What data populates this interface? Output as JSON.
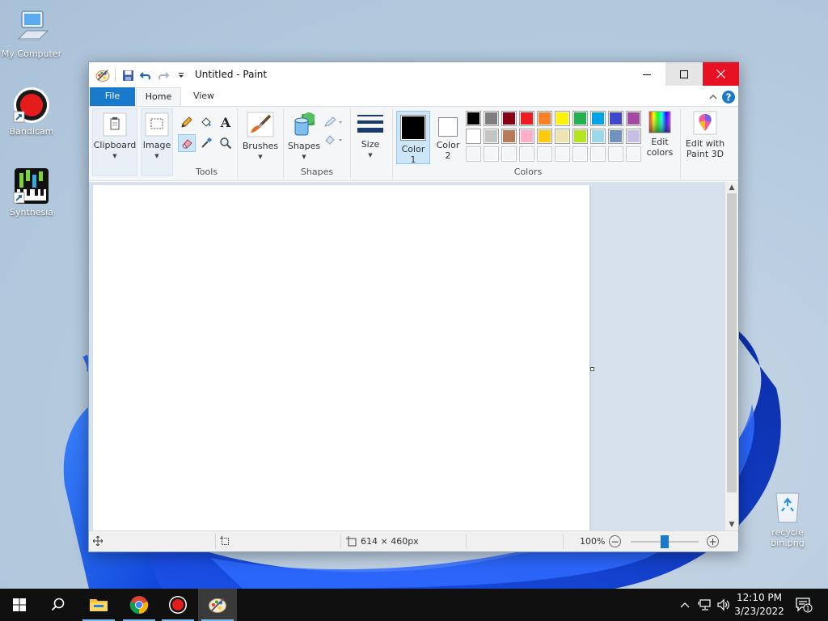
{
  "desktop": {
    "icons": [
      {
        "label": "My Computer"
      },
      {
        "label": "Bandicam"
      },
      {
        "label": "Synthesia"
      },
      {
        "label": "recycle bin.png"
      }
    ]
  },
  "window": {
    "title": "Untitled - Paint",
    "tabs": {
      "file": "File",
      "home": "Home",
      "view": "View"
    },
    "ribbon": {
      "clipboard": "Clipboard",
      "image": "Image",
      "tools_group": "Tools",
      "brushes": "Brushes",
      "shapes": "Shapes",
      "shapes_group": "Shapes",
      "size": "Size",
      "color1_line1": "Color",
      "color1_line2": "1",
      "color2_line1": "Color",
      "color2_line2": "2",
      "colors_group": "Colors",
      "edit_colors_line1": "Edit",
      "edit_colors_line2": "colors",
      "paint3d_line1": "Edit with",
      "paint3d_line2": "Paint 3D"
    },
    "palette_row1": [
      "#000000",
      "#7f7f7f",
      "#880015",
      "#ed1c24",
      "#ff7f27",
      "#fff200",
      "#22b14c",
      "#00a2e8",
      "#3f48cc",
      "#a349a4"
    ],
    "palette_row2": [
      "#ffffff",
      "#c3c3c3",
      "#b97a57",
      "#ffaec9",
      "#ffc90e",
      "#efe4b0",
      "#b5e61d",
      "#99d9ea",
      "#7092be",
      "#c8bfe7"
    ],
    "color1": "#000000",
    "color2": "#ffffff",
    "status": {
      "canvas_size": "614 × 460px",
      "zoom": "100%"
    }
  },
  "taskbar": {
    "time": "12:10 PM",
    "date": "3/23/2022",
    "notification_count": "1"
  },
  "colors": {
    "accent": "#1979ca",
    "close_red": "#e81123",
    "workspace": "#d7e1ee"
  }
}
